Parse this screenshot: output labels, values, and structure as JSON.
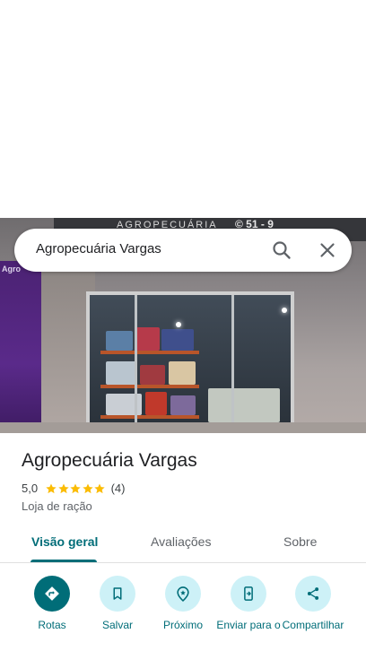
{
  "search": {
    "query": "Agropecuária Vargas"
  },
  "photo": {
    "sign_text": "AGROPECUÁRIA",
    "sign_phone": "© 51 - 9",
    "panel_label": "Agro"
  },
  "place": {
    "name": "Agropecuária Vargas",
    "rating": "5,0",
    "stars": 5,
    "review_count": "(4)",
    "category": "Loja de ração"
  },
  "tabs": [
    {
      "label": "Visão geral",
      "active": true
    },
    {
      "label": "Avaliações",
      "active": false
    },
    {
      "label": "Sobre",
      "active": false
    }
  ],
  "actions": [
    {
      "label": "Rotas",
      "icon": "directions-icon"
    },
    {
      "label": "Salvar",
      "icon": "bookmark-icon"
    },
    {
      "label": "Próximo",
      "icon": "nearby-icon"
    },
    {
      "label": "Enviar para o",
      "icon": "send-to-phone-icon"
    },
    {
      "label": "Compartilhar",
      "icon": "share-icon"
    }
  ],
  "colors": {
    "accent": "#006d78",
    "action_bg": "#cdf1f7",
    "star": "#fbbc04"
  }
}
